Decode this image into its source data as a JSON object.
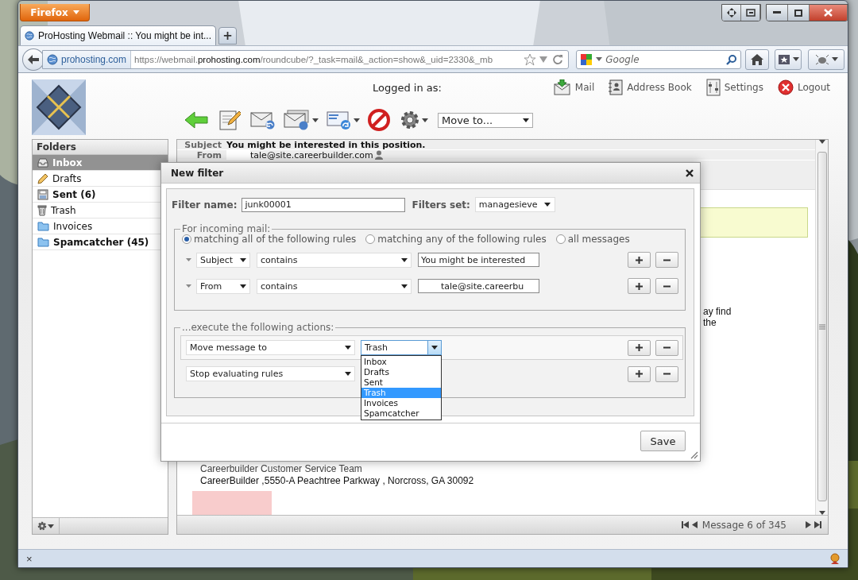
{
  "browser": {
    "menu_button": "Firefox",
    "tabs": [
      {
        "title": "ProHosting Webmail :: You might be int...",
        "selected": true
      }
    ],
    "new_tab": "+",
    "identity": "prohosting.com",
    "url": {
      "prefix": "https://webmail.",
      "domain": "prohosting.com",
      "path": "/roundcube/?_task=mail&_action=show&_uid=2330&_mb"
    },
    "search_placeholder": "Google",
    "status_close": "×"
  },
  "header": {
    "logged_in": "Logged in as:",
    "nav": [
      {
        "kind": "mail",
        "label": "Mail"
      },
      {
        "kind": "addressbook",
        "label": "Address Book"
      },
      {
        "kind": "settings",
        "label": "Settings"
      },
      {
        "kind": "logout",
        "label": "Logout"
      }
    ]
  },
  "toolbar": {
    "move_to": "Move to..."
  },
  "folders": {
    "title": "Folders",
    "items": [
      {
        "kind": "inbox",
        "label": "Inbox",
        "selected": true,
        "unread": true
      },
      {
        "kind": "drafts",
        "label": "Drafts",
        "selected": false,
        "unread": false
      },
      {
        "kind": "sent",
        "label": "Sent (6)",
        "selected": false,
        "unread": true
      },
      {
        "kind": "trash",
        "label": "Trash",
        "selected": false,
        "unread": false
      },
      {
        "kind": "folder",
        "label": "Invoices",
        "selected": false,
        "unread": false
      },
      {
        "kind": "folder",
        "label": "Spamcatcher (45)",
        "selected": false,
        "unread": true
      }
    ]
  },
  "message": {
    "headers": [
      {
        "label": "Subject",
        "value": "You might be interested in this position.",
        "redacted": false
      },
      {
        "label": "From",
        "value": "tale@site.careerbuilder.com",
        "redacted": true
      }
    ],
    "fragments": [
      "ay find",
      "the"
    ],
    "signature": [
      "Careerbuilder Customer Service Team",
      "CareerBuilder ,5550-A Peachtree Parkway , Norcross, GA 30092"
    ],
    "pager": "Message 6 of 345"
  },
  "dialog": {
    "title": "New filter",
    "filter_name_label": "Filter name:",
    "filter_name": "junk00001",
    "set_label": "Filters set:",
    "set_value": "managesieve",
    "rules_legend": "For incoming mail:",
    "match_options": [
      {
        "label": "matching all of the following rules",
        "selected": true
      },
      {
        "label": "matching any of the following rules",
        "selected": false
      },
      {
        "label": "all messages",
        "selected": false
      }
    ],
    "rules": [
      {
        "header": "Subject",
        "operator": "contains",
        "value": "You might be interested",
        "redacted": false
      },
      {
        "header": "From",
        "operator": "contains",
        "value": "tale@site.careerbu",
        "redacted": true
      }
    ],
    "actions_legend": "...execute the following actions:",
    "actions": [
      {
        "action": "Move message to",
        "target": "Trash",
        "open": true
      },
      {
        "action": "Stop evaluating rules",
        "open": false
      }
    ],
    "folder_options": [
      {
        "label": "Inbox",
        "selected": false
      },
      {
        "label": "Drafts",
        "selected": false
      },
      {
        "label": "Sent",
        "selected": false
      },
      {
        "label": "Trash",
        "selected": true
      },
      {
        "label": "Invoices",
        "selected": false
      },
      {
        "label": "Spamcatcher",
        "selected": false
      }
    ],
    "save": "Save"
  }
}
